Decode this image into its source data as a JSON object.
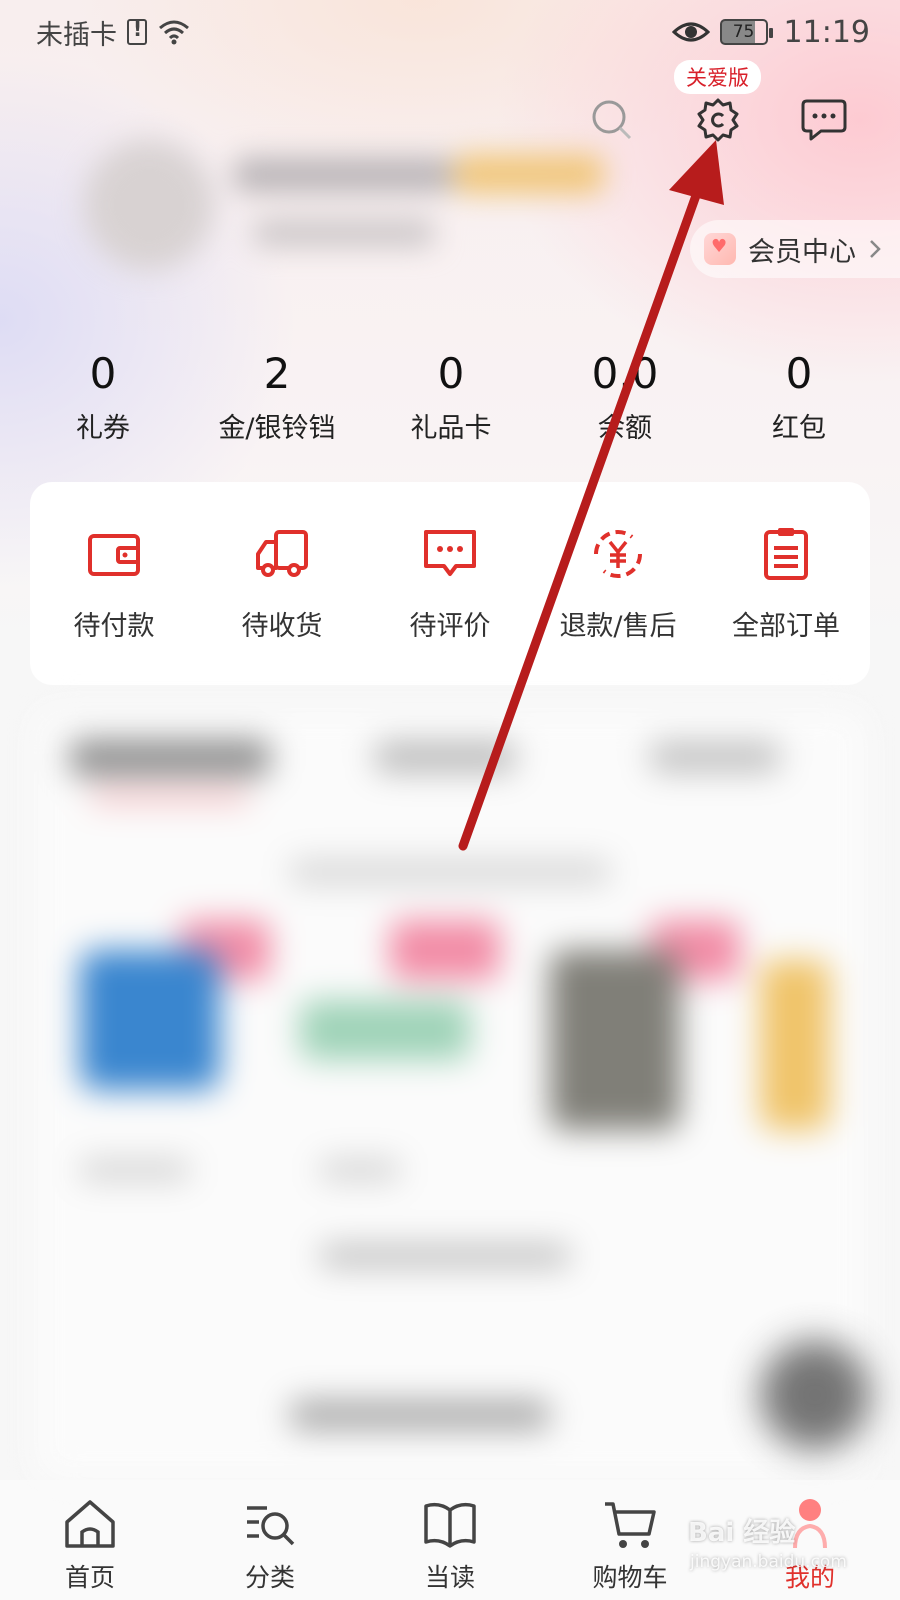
{
  "status_bar": {
    "carrier": "未插卡",
    "battery": "75",
    "time": "11:19"
  },
  "header": {
    "care_mode_badge": "关爱版",
    "icons": [
      "search-icon",
      "settings-icon",
      "message-icon"
    ]
  },
  "member_center": {
    "label": "会员中心"
  },
  "stats": [
    {
      "value": "0",
      "label": "礼券"
    },
    {
      "value": "2",
      "label": "金/银铃铛"
    },
    {
      "value": "0",
      "label": "礼品卡"
    },
    {
      "value": "0.0",
      "label": "余额"
    },
    {
      "value": "0",
      "label": "红包"
    }
  ],
  "orders": [
    {
      "label": "待付款",
      "icon": "wallet-icon"
    },
    {
      "label": "待收货",
      "icon": "truck-icon"
    },
    {
      "label": "待评价",
      "icon": "comment-icon"
    },
    {
      "label": "退款/售后",
      "icon": "refund-icon"
    },
    {
      "label": "全部订单",
      "icon": "order-list-icon"
    }
  ],
  "tabbar": [
    {
      "label": "首页",
      "icon": "home-icon"
    },
    {
      "label": "分类",
      "icon": "category-search-icon"
    },
    {
      "label": "当读",
      "icon": "book-icon"
    },
    {
      "label": "购物车",
      "icon": "cart-icon"
    },
    {
      "label": "我的",
      "icon": "profile-icon",
      "active": true
    }
  ],
  "watermark": {
    "text": "Bai 经验",
    "sub": "jingyan.baidu.com"
  },
  "colors": {
    "accent": "#e0302b",
    "annotation_arrow": "#b71c1c"
  }
}
